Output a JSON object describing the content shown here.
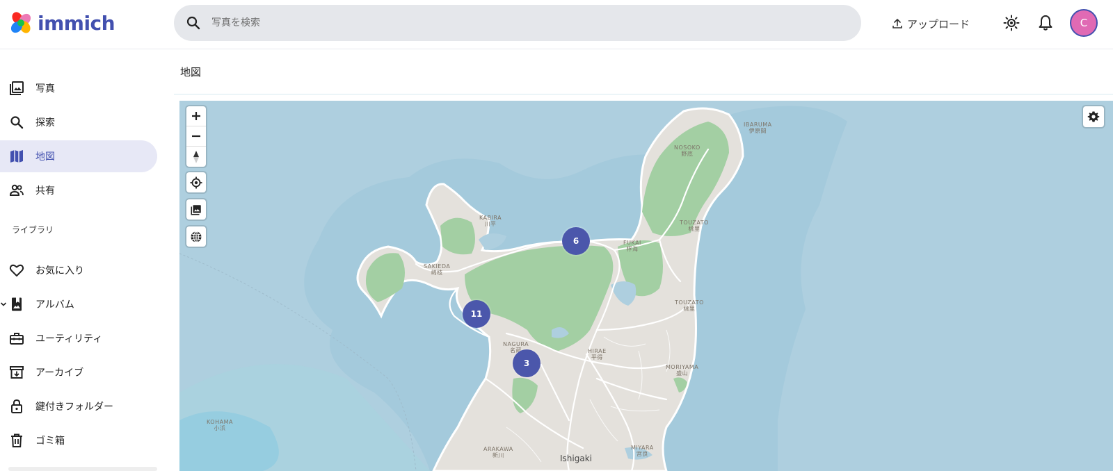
{
  "app": {
    "name": "immich"
  },
  "search": {
    "placeholder": "写真を検索"
  },
  "header": {
    "upload_label": "アップロード",
    "avatar_initial": "C"
  },
  "sidebar": {
    "items": [
      {
        "label": "写真",
        "icon": "photos-icon"
      },
      {
        "label": "探索",
        "icon": "search-icon"
      },
      {
        "label": "地図",
        "icon": "map-icon",
        "active": true
      },
      {
        "label": "共有",
        "icon": "people-icon"
      }
    ],
    "library_label": "ライブラリ",
    "library_items": [
      {
        "label": "お気に入り",
        "icon": "heart-icon"
      },
      {
        "label": "アルバム",
        "icon": "album-icon"
      },
      {
        "label": "ユーティリティ",
        "icon": "toolbox-icon"
      },
      {
        "label": "アーカイブ",
        "icon": "archive-icon"
      },
      {
        "label": "鍵付きフォルダー",
        "icon": "lock-icon"
      },
      {
        "label": "ゴミ箱",
        "icon": "trash-icon"
      }
    ]
  },
  "page": {
    "title": "地図"
  },
  "map": {
    "clusters": [
      {
        "count": "6"
      },
      {
        "count": "11"
      },
      {
        "count": "3"
      }
    ],
    "labels": {
      "ibaruma": "IBARUMA",
      "ibaruma_jp": "伊原間",
      "nosoko": "NOSOKO",
      "nosoko_jp": "野底",
      "kabira": "KABIRA",
      "kabira_jp": "川平",
      "touzato1": "TOUZATO",
      "touzato1_jp": "桃里",
      "fukai": "FUKAI",
      "fukai_jp": "桴海",
      "sakieda": "SAKIEDA",
      "sakieda_jp": "崎枝",
      "touzato2": "TOUZATO",
      "touzato2_jp": "桃里",
      "nagura": "NAGURA",
      "nagura_jp": "名蔵",
      "hirae": "HIRAE",
      "hirae_jp": "平得",
      "moriyama": "MORIYAMA",
      "moriyama_jp": "盛山",
      "kohama": "KOHAMA",
      "kohama_jp": "小浜",
      "arakawa": "ARAKAWA",
      "arakawa_jp": "新川",
      "miyara": "MIYARA",
      "miyara_jp": "宮良",
      "ishigaki": "Ishigaki"
    },
    "colors": {
      "water": "#aecfdf",
      "land": "#e4e1dc",
      "forest": "#a3cfa3",
      "cluster": "#4b57ab"
    }
  }
}
